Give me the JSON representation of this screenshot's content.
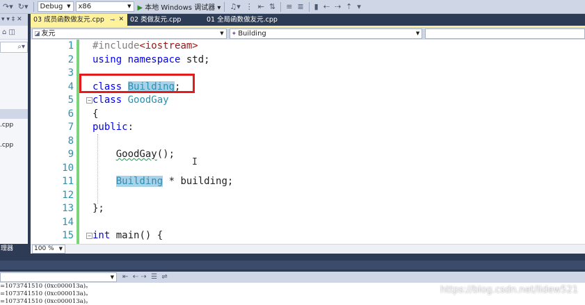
{
  "toolbar": {
    "config": "Debug",
    "platform": "x86",
    "run_label": "本地 Windows 调试器"
  },
  "solution_explorer": {
    "items": [
      ".cpp",
      ".cpp"
    ],
    "footer_label": "理器"
  },
  "tabs": [
    {
      "label": "03 成员函数做友元.cpp",
      "active": true
    },
    {
      "label": "02 类做友元.cpp",
      "active": false
    },
    {
      "label": "01 全局函数做友元.cpp",
      "active": false
    }
  ],
  "navbar": {
    "scope": "友元",
    "member": "Building"
  },
  "editor": {
    "line_numbers": [
      "1",
      "2",
      "3",
      "4",
      "5",
      "6",
      "7",
      "8",
      "9",
      "10",
      "11",
      "12",
      "13",
      "14",
      "15"
    ],
    "code": {
      "l1_directive": "#include",
      "l1_file": "<iostream>",
      "l2_using": "using",
      "l2_namespace": "namespace",
      "l2_rest": " std;",
      "l4_class": "class",
      "l4_name": "Building",
      "l4_semi": ";",
      "l5_class": "class",
      "l5_name": "GoodGay",
      "l6": "{",
      "l7_public": "public",
      "l7_colon": ":",
      "l9_ctor": "GoodGay",
      "l9_rest": "();",
      "l11_type": "Building",
      "l11_rest": " * building;",
      "l13": "};",
      "l15_int": "int",
      "l15_rest": " main() {"
    }
  },
  "zoom": "100 %",
  "output": {
    "lines": [
      "=1073741510 (0xc000013a)。",
      "=1073741510 (0xc000013a)。",
      "=1073741510 (0xc000013a)。"
    ]
  },
  "watermark": "https://blog.csdn.net/lidew521"
}
